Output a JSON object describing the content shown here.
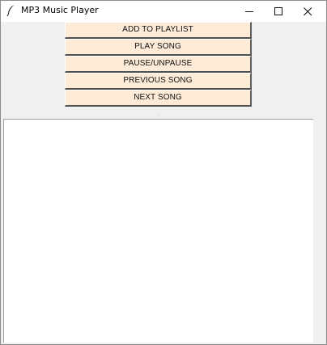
{
  "window": {
    "title": "MP3 Music Player",
    "icon": "feather-icon"
  },
  "window_controls": {
    "minimize_icon": "minimize-icon",
    "maximize_icon": "maximize-icon",
    "close_icon": "close-icon"
  },
  "buttons": {
    "add_to_playlist": "ADD TO PLAYLIST",
    "play_song": "PLAY SONG",
    "pause_unpause": "PAUSE/UNPAUSE",
    "previous_song": "PREVIOUS SONG",
    "next_song": "NEXT SONG"
  },
  "colors": {
    "button_background": "#fdebd8",
    "window_background": "#f0f0f0",
    "playlist_background": "#ffffff"
  }
}
